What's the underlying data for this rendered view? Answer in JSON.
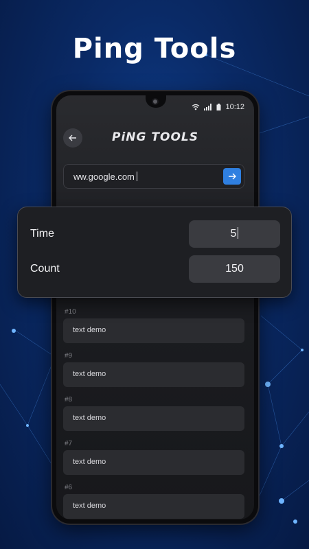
{
  "headline": "Ping Tools",
  "status": {
    "time": "10:12"
  },
  "header": {
    "title": "PiNG TOOLS"
  },
  "url": {
    "value": "ww.google.com"
  },
  "settings": {
    "time_label": "Time",
    "time_value": "5",
    "count_label": "Count",
    "count_value": "150"
  },
  "results": [
    {
      "num": "#10",
      "text": "text demo"
    },
    {
      "num": "#9",
      "text": "text demo"
    },
    {
      "num": "#8",
      "text": "text demo"
    },
    {
      "num": "#7",
      "text": "text demo"
    },
    {
      "num": "#6",
      "text": "text demo"
    }
  ],
  "colors": {
    "accent": "#2f7fe0",
    "background": "#0a2a66",
    "panel": "#1e1f23"
  },
  "icons": {
    "back": "arrow-left-icon",
    "go": "arrow-right-icon",
    "wifi": "wifi-icon",
    "signal": "signal-icon",
    "battery": "battery-icon"
  }
}
